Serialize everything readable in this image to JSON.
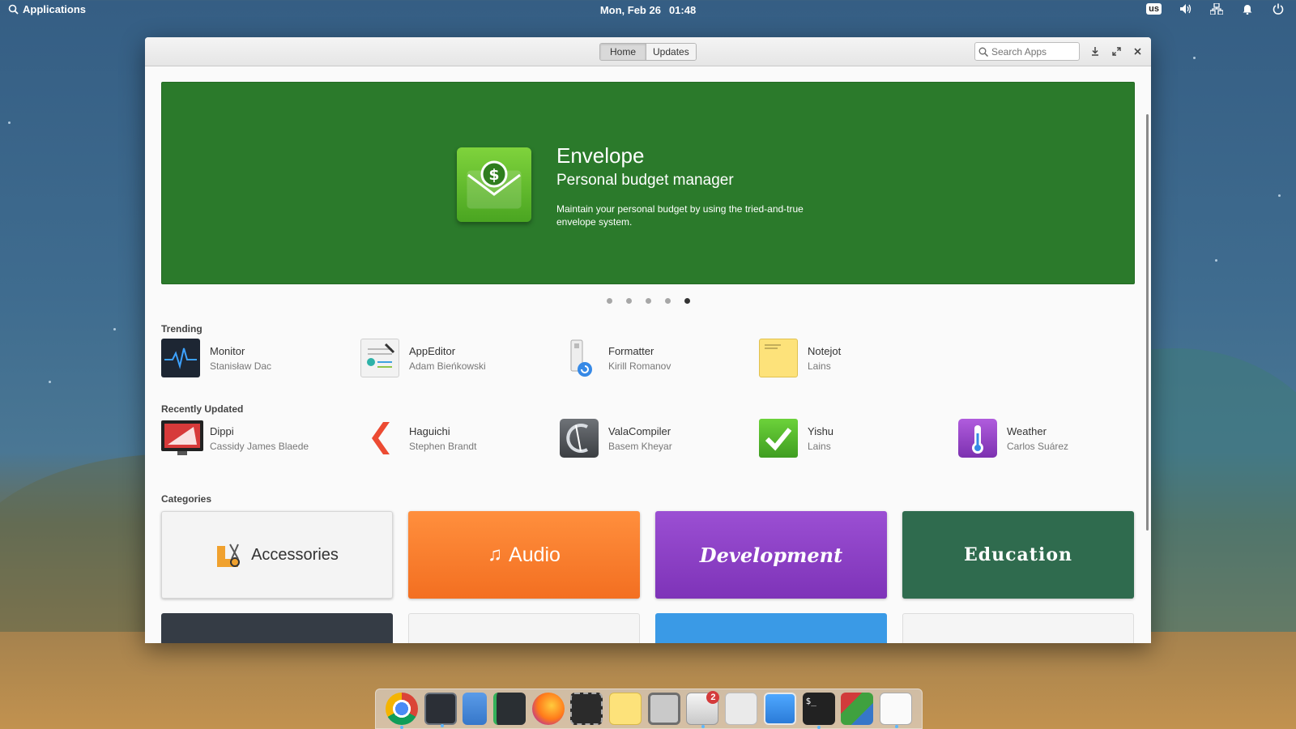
{
  "top_panel": {
    "applications_label": "Applications",
    "date": "Mon, Feb 26",
    "time": "01:48",
    "keyboard_layout": "us"
  },
  "window": {
    "view_switcher": {
      "home_label": "Home",
      "updates_label": "Updates"
    },
    "search": {
      "placeholder": "Search Apps"
    }
  },
  "banner": {
    "title": "Envelope",
    "subtitle": "Personal budget manager",
    "description": "Maintain your personal budget by using the tried-and-true envelope system.",
    "color": "#2b7a2b",
    "page_count": 5,
    "active_page": 5
  },
  "sections": {
    "trending": "Trending",
    "recently_updated": "Recently Updated",
    "categories": "Categories"
  },
  "trending": [
    {
      "name": "Monitor",
      "author": "Stanisław Dac",
      "icon": "monitor-app-icon"
    },
    {
      "name": "AppEditor",
      "author": "Adam Bieńkowski",
      "icon": "appeditor-app-icon"
    },
    {
      "name": "Formatter",
      "author": "Kirill Romanov",
      "icon": "formatter-app-icon"
    },
    {
      "name": "Notejot",
      "author": "Lains",
      "icon": "notejot-app-icon"
    }
  ],
  "recently_updated": [
    {
      "name": "Dippi",
      "author": "Cassidy James Blaede",
      "icon": "dippi-app-icon"
    },
    {
      "name": "Haguichi",
      "author": "Stephen Brandt",
      "icon": "haguichi-app-icon"
    },
    {
      "name": "ValaCompiler",
      "author": "Basem Kheyar",
      "icon": "valacompiler-app-icon"
    },
    {
      "name": "Yishu",
      "author": "Lains",
      "icon": "yishu-app-icon"
    },
    {
      "name": "Weather",
      "author": "Carlos Suárez",
      "icon": "weather-app-icon"
    }
  ],
  "categories": [
    {
      "label": "Accessories",
      "color": "#f4f4f4"
    },
    {
      "label": "Audio",
      "color": "#f57b2c"
    },
    {
      "label": "Development",
      "color": "#8b3fc4"
    },
    {
      "label": "Education",
      "color": "#2f6b4e"
    }
  ],
  "dock": {
    "items": [
      "chrome-icon",
      "code-editor-icon",
      "files-icon",
      "vscode-icon",
      "firefox-icon",
      "screenshot-icon",
      "notes-icon",
      "boxes-icon",
      "appcenter-icon",
      "switchboard-icon",
      "window-icon",
      "terminal-icon",
      "multitasking-icon",
      "text-editor-icon"
    ],
    "appcenter_badge": "2"
  }
}
